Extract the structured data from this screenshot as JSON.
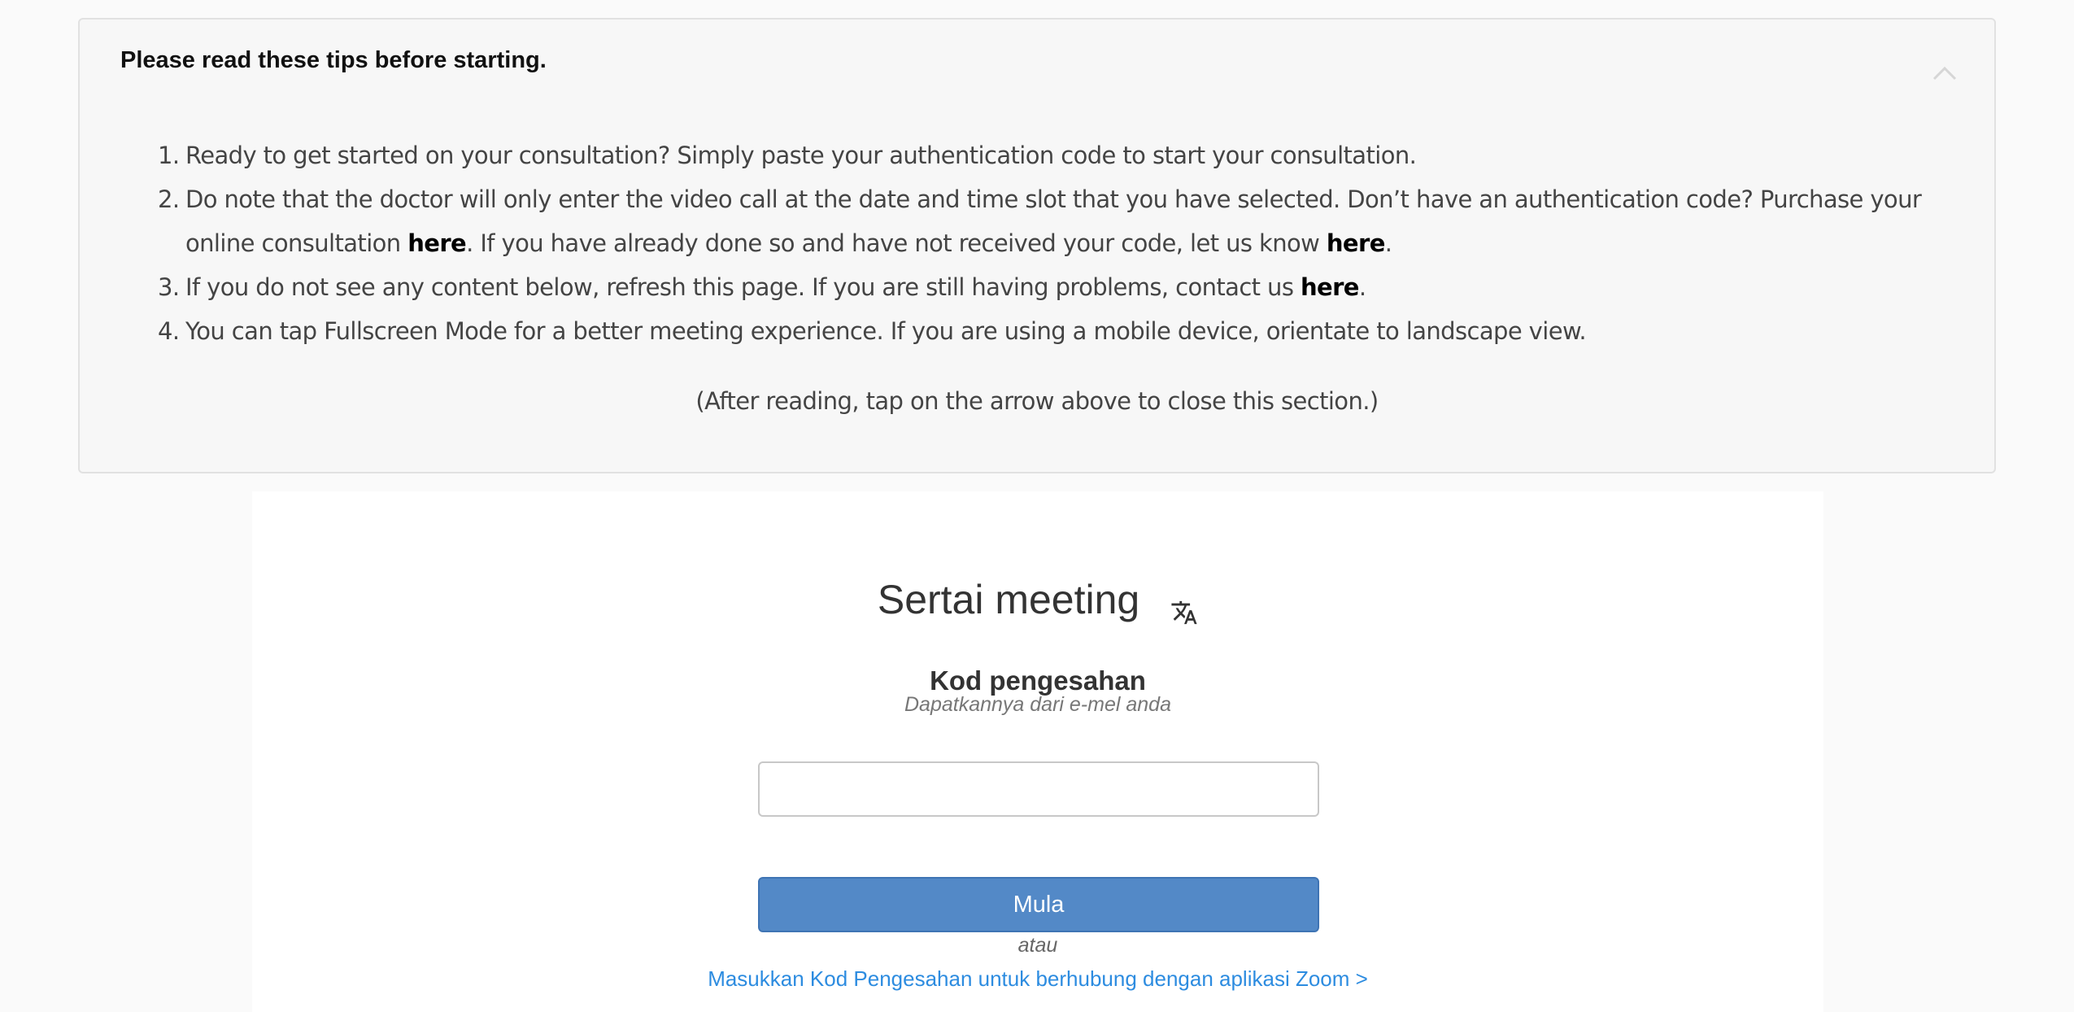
{
  "tips": {
    "title": "Please read these tips before starting.",
    "items": [
      {
        "num": "1.",
        "text": "Ready to get started on your consultation? Simply paste your authentication code to start your consultation."
      },
      {
        "num": "2.",
        "text_a": "Do note that the doctor will only enter the video call at the date and time slot that you have selected. Don’t have an authentication code? Purchase your online consultation ",
        "link_a": "here",
        "text_b": ". If you have already done so and have not received your code, let us know ",
        "link_b": "here",
        "text_c": "."
      },
      {
        "num": "3.",
        "text_a": "If you do not see any content below, refresh this page. If you are still having problems, contact us ",
        "link_a": "here",
        "text_b": "."
      },
      {
        "num": "4.",
        "text": "You can tap Fullscreen Mode for a better meeting experience. If you are using a mobile device, orientate to landscape view."
      }
    ],
    "note": "(After reading, tap on the arrow above to close this section.)",
    "toggle_icon": "chevron-up-icon"
  },
  "join": {
    "title": "Sertai meeting",
    "translate_icon": "translate-icon",
    "code_label": "Kod pengesahan",
    "code_hint": "Dapatkannya dari e-mel anda",
    "code_value": "",
    "start_label": "Mula",
    "or_text": "atau",
    "zoom_link": "Masukkan Kod Pengesahan untuk berhubung dengan aplikasi Zoom >"
  },
  "colors": {
    "page_bg": "#fafafa",
    "panel_bg": "#f7f7f7",
    "button_bg": "#5389c7",
    "link": "#2d8ce0"
  }
}
